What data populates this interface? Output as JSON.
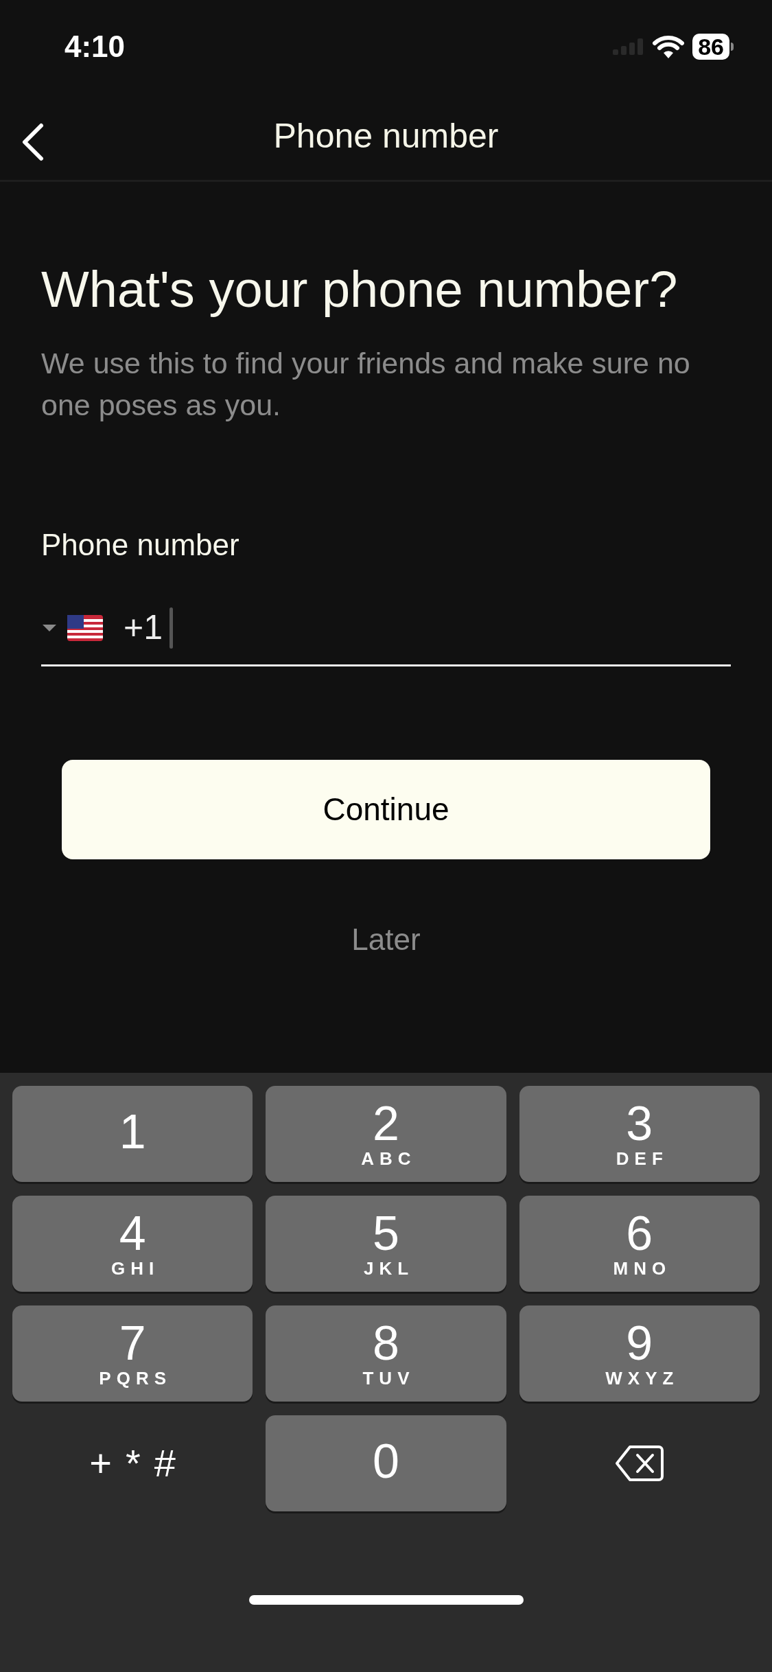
{
  "status_bar": {
    "time": "4:10",
    "battery": "86"
  },
  "nav": {
    "title": "Phone number"
  },
  "heading": "What's your phone number?",
  "subtitle": "We use this to find your friends and make sure no one poses as you.",
  "phone_field": {
    "label": "Phone number",
    "value": "+1"
  },
  "continue_button": "Continue",
  "later_link": "Later",
  "keypad": [
    {
      "kind": "digit",
      "digit": "1"
    },
    {
      "kind": "digit",
      "digit": "2",
      "letters": "ABC"
    },
    {
      "kind": "digit",
      "digit": "3",
      "letters": "DEF"
    },
    {
      "kind": "digit",
      "digit": "4",
      "letters": "GHI"
    },
    {
      "kind": "digit",
      "digit": "5",
      "letters": "JKL"
    },
    {
      "kind": "digit",
      "digit": "6",
      "letters": "MNO"
    },
    {
      "kind": "digit",
      "digit": "7",
      "letters": "PQRS"
    },
    {
      "kind": "digit",
      "digit": "8",
      "letters": "TUV"
    },
    {
      "kind": "digit",
      "digit": "9",
      "letters": "WXYZ"
    },
    {
      "kind": "symbols",
      "label": "+*#"
    },
    {
      "kind": "digit",
      "digit": "0"
    },
    {
      "kind": "delete"
    }
  ]
}
